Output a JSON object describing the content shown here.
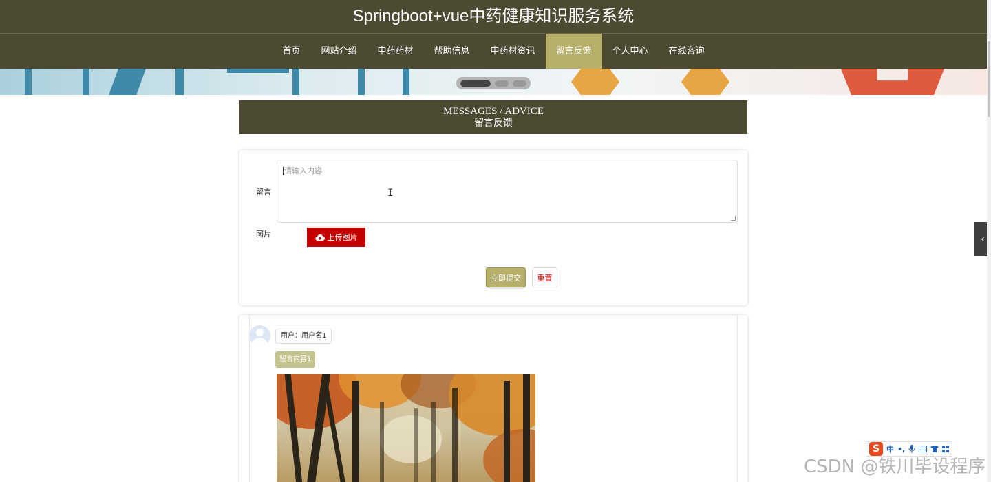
{
  "app": {
    "title": "Springboot+vue中药健康知识服务系统"
  },
  "nav": {
    "items": [
      {
        "label": "首页"
      },
      {
        "label": "网站介绍"
      },
      {
        "label": "中药药材"
      },
      {
        "label": "帮助信息"
      },
      {
        "label": "中药材资讯"
      },
      {
        "label": "留言反馈",
        "active": true
      },
      {
        "label": "个人中心"
      },
      {
        "label": "在线咨询"
      }
    ],
    "accent_color": "#b6b06a",
    "bg_color": "#4c4a32"
  },
  "carousel": {
    "slide_count": 3,
    "active_index": 0
  },
  "section": {
    "title_en": "MESSAGES / ADVICE",
    "title_cn": "留言反馈"
  },
  "form": {
    "message_label": "留言",
    "message_placeholder": "请输入内容",
    "image_label": "图片",
    "upload_label": "上传图片",
    "upload_icon": "cloud-upload-icon",
    "submit_label": "立即提交",
    "reset_label": "重置"
  },
  "messages": [
    {
      "user": "用户：用户名1",
      "content": "留言内容1",
      "image": "autumn-forest-photo"
    }
  ],
  "ime": {
    "logo": "S",
    "mode": "中",
    "items": [
      "•,",
      "mic-icon",
      "keyboard-icon",
      "shirt-icon",
      "grid-icon"
    ]
  },
  "watermark": "CSDN @铁川毕设程序"
}
